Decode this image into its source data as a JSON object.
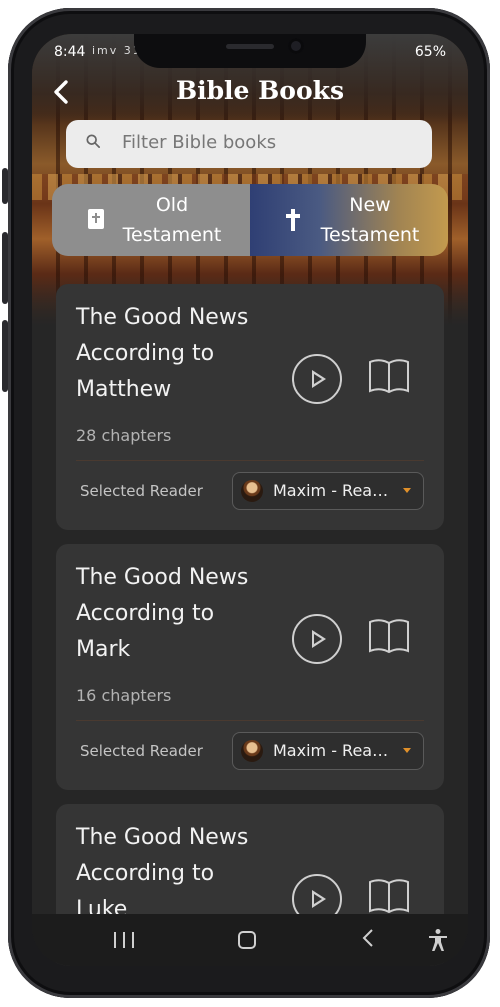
{
  "status": {
    "time": "8:44",
    "left_icons": "imv 31",
    "right_text": "65%"
  },
  "header": {
    "back_icon": "chevron-left-icon",
    "title": "Bible Books"
  },
  "search": {
    "placeholder": "Filter Bible books"
  },
  "testament_toggle": {
    "old": {
      "line1": "Old",
      "line2": "Testament",
      "icon": "book-cross-icon"
    },
    "new": {
      "line1": "New",
      "line2": "Testament",
      "icon": "cross-icon",
      "selected": true
    }
  },
  "books": [
    {
      "line1": "The Good News",
      "line2": "According to",
      "line3": "Matthew",
      "chapters": "28 chapters",
      "reader_label": "Selected Reader",
      "reader": "Maxim - Reader"
    },
    {
      "line1": "The Good News",
      "line2": "According to",
      "line3": "Mark",
      "chapters": "16 chapters",
      "reader_label": "Selected Reader",
      "reader": "Maxim - Reader"
    },
    {
      "line1": "The Good News",
      "line2": "According to",
      "line3": "Luke"
    }
  ],
  "colors": {
    "card": "#353535",
    "background": "#262626",
    "accent": "#e0902a",
    "search_bg": "#ececec"
  }
}
